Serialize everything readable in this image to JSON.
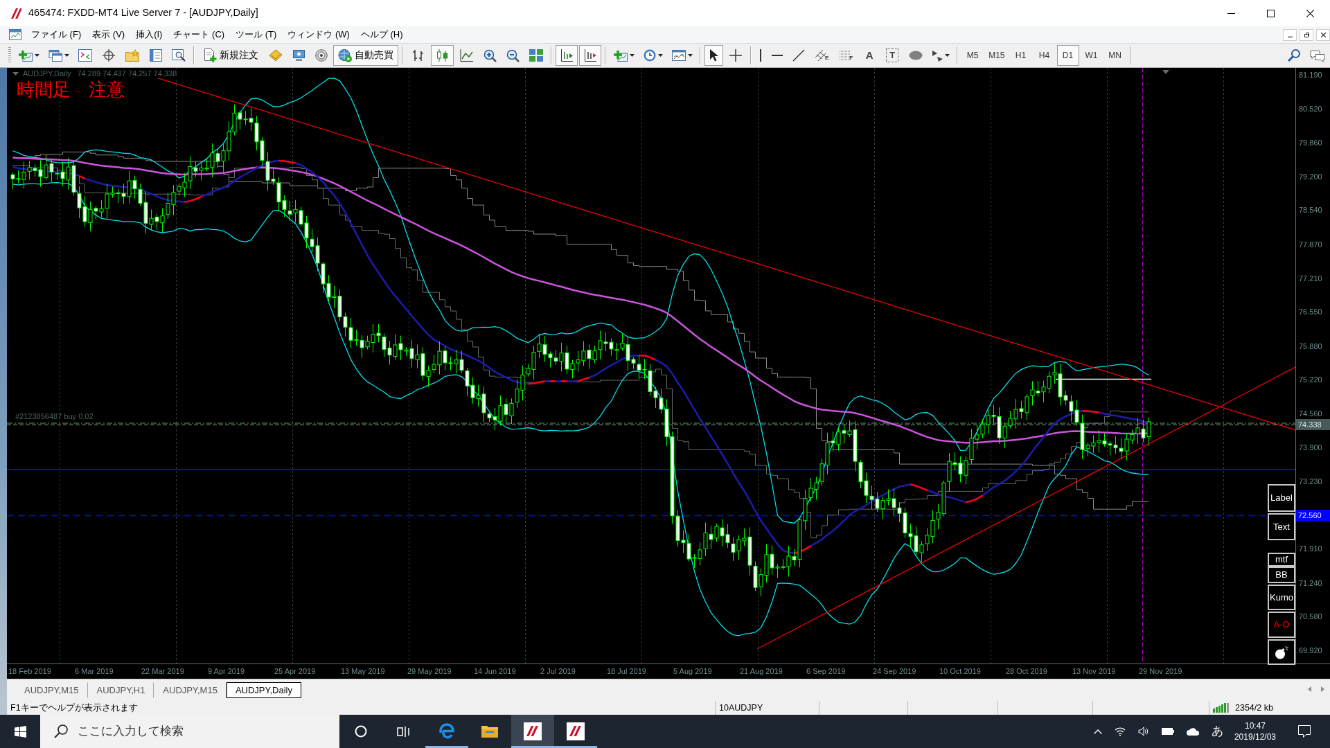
{
  "window": {
    "title": "465474: FXDD-MT4 Live Server 7 - [AUDJPY,Daily]"
  },
  "menu": [
    "ファイル (F)",
    "表示 (V)",
    "挿入(I)",
    "チャート (C)",
    "ツール (T)",
    "ウィンドウ (W)",
    "ヘルプ (H)"
  ],
  "toolbar": {
    "new_order": "新規注文",
    "autotrading": {
      "label": "自動売買",
      "on": true
    },
    "chart_types": [
      {
        "selected": false
      },
      {
        "selected": true
      },
      {
        "selected": false
      }
    ],
    "view_toggles": [
      {
        "on": true
      },
      {
        "on": true
      }
    ],
    "pointer_tools": [
      {
        "selected": true
      },
      {
        "selected": false
      }
    ],
    "channel_mark": "E",
    "fibo_mark": "F",
    "text_tool": "A",
    "label_tool": "T",
    "timeframes": [
      {
        "label": "M5",
        "selected": false
      },
      {
        "label": "M15",
        "selected": false
      },
      {
        "label": "H1",
        "selected": false
      },
      {
        "label": "H4",
        "selected": false
      },
      {
        "label": "D1",
        "selected": true
      },
      {
        "label": "W1",
        "selected": false
      },
      {
        "label": "MN",
        "selected": false
      }
    ]
  },
  "chart": {
    "symbol": "AUDJPY,Daily",
    "ohlc": "74.289 74.437 74.257 74.338",
    "note": "時間足　注意",
    "order_label": "#2123856487 buy 0.02",
    "price_ticks": [
      "81.190",
      "80.520",
      "79.860",
      "79.200",
      "78.540",
      "77.870",
      "77.210",
      "76.550",
      "75.880",
      "75.220",
      "74.560",
      "73.900",
      "73.230",
      "71.910",
      "71.240",
      "70.580",
      "69.920"
    ],
    "price_tags": [
      {
        "kind": "bid",
        "label": "74.338"
      },
      {
        "kind": "level",
        "label": "72.560"
      }
    ],
    "date_ticks": [
      "18 Feb 2019",
      "6 Mar 2019",
      "22 Mar 2019",
      "9 Apr 2019",
      "25 Apr 2019",
      "13 May 2019",
      "29 May 2019",
      "14 Jun 2019",
      "2 Jul 2019",
      "18 Jul 2019",
      "5 Aug 2019",
      "21 Aug 2019",
      "6 Sep 2019",
      "24 Sep 2019",
      "10 Oct 2019",
      "28 Oct 2019",
      "13 Nov 2019",
      "29 Nov 2019"
    ],
    "side_buttons": [
      {
        "label": "Label",
        "color": "#ffffff"
      },
      {
        "label": "Text",
        "color": "#ffffff"
      },
      {
        "label": "mtf",
        "color": "#ffffff"
      },
      {
        "label": "BB",
        "color": "#ffffff"
      },
      {
        "label": "Kumo",
        "color": "#ffffff"
      },
      {
        "label": "A-O",
        "color": "#ff0000"
      }
    ]
  },
  "tabs": [
    {
      "label": "AUDJPY,M15",
      "selected": false
    },
    {
      "label": "AUDJPY,H1",
      "selected": false
    },
    {
      "label": "AUDJPY,M15",
      "selected": false
    },
    {
      "label": "AUDJPY,Daily",
      "selected": true
    }
  ],
  "status_bar": {
    "help": "F1キーでヘルプが表示されます",
    "profile": "10AUDJPY",
    "traffic": "2354/2 kb"
  },
  "taskbar": {
    "search": {
      "placeholder": "ここに入力して検索"
    },
    "apps": [
      {
        "running": true,
        "selected": false
      },
      {
        "running": false,
        "selected": false
      },
      {
        "running": true,
        "selected": true
      },
      {
        "running": true,
        "selected": false
      }
    ],
    "ime": "あ",
    "time": "10:47",
    "date": "2019/12/03"
  }
}
